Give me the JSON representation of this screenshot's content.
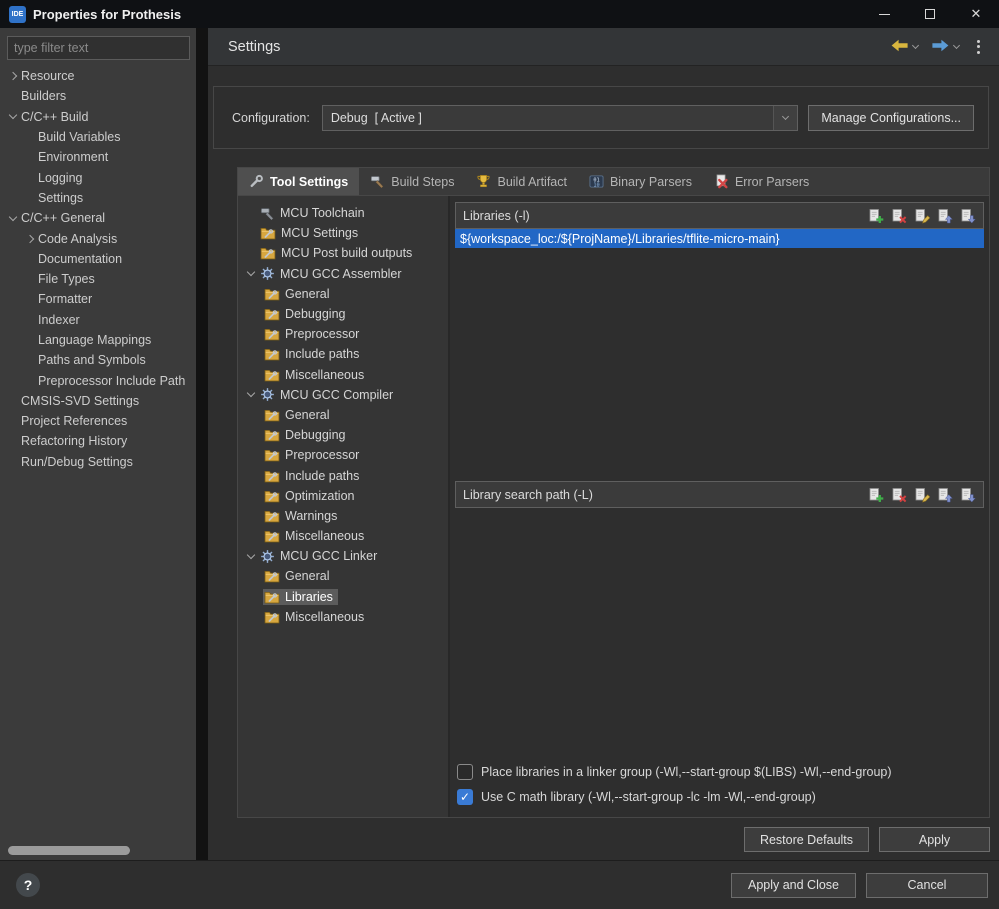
{
  "window": {
    "title": "Properties for Prothesis",
    "icon_text": "IDE"
  },
  "header": {
    "title": "Settings"
  },
  "help": {
    "glyph": "?"
  },
  "sidebar": {
    "filter_placeholder": "type filter text",
    "tree": [
      {
        "label": "Resource",
        "level": 0,
        "chevron": "collapsed"
      },
      {
        "label": "Builders",
        "level": 0,
        "chevron": null
      },
      {
        "label": "C/C++ Build",
        "level": 0,
        "chevron": "expanded"
      },
      {
        "label": "Build Variables",
        "level": 1,
        "chevron": null
      },
      {
        "label": "Environment",
        "level": 1,
        "chevron": null
      },
      {
        "label": "Logging",
        "level": 1,
        "chevron": null
      },
      {
        "label": "Settings",
        "level": 1,
        "chevron": null
      },
      {
        "label": "C/C++ General",
        "level": 0,
        "chevron": "expanded"
      },
      {
        "label": "Code Analysis",
        "level": 1,
        "chevron": "collapsed"
      },
      {
        "label": "Documentation",
        "level": 1,
        "chevron": null
      },
      {
        "label": "File Types",
        "level": 1,
        "chevron": null
      },
      {
        "label": "Formatter",
        "level": 1,
        "chevron": null
      },
      {
        "label": "Indexer",
        "level": 1,
        "chevron": null
      },
      {
        "label": "Language Mappings",
        "level": 1,
        "chevron": null
      },
      {
        "label": "Paths and Symbols",
        "level": 1,
        "chevron": null
      },
      {
        "label": "Preprocessor Include Path",
        "level": 1,
        "chevron": null
      },
      {
        "label": "CMSIS-SVD Settings",
        "level": 0,
        "chevron": null
      },
      {
        "label": "Project References",
        "level": 0,
        "chevron": null
      },
      {
        "label": "Refactoring History",
        "level": 0,
        "chevron": null
      },
      {
        "label": "Run/Debug Settings",
        "level": 0,
        "chevron": null
      }
    ]
  },
  "config": {
    "label": "Configuration:",
    "value": "Debug  [ Active ]",
    "manage": "Manage Configurations..."
  },
  "tabs": [
    {
      "label": "Tool Settings",
      "icon": "wrench-icon",
      "active": true
    },
    {
      "label": "Build Steps",
      "icon": "hammer-icon",
      "active": false
    },
    {
      "label": "Build Artifact",
      "icon": "trophy-icon",
      "active": false
    },
    {
      "label": "Binary Parsers",
      "icon": "binary-icon",
      "active": false
    },
    {
      "label": "Error Parsers",
      "icon": "error-icon",
      "active": false
    }
  ],
  "tool_tree": [
    {
      "label": "MCU Toolchain",
      "level": 0,
      "icon": "toolchain-icon",
      "chevron": null,
      "selected": false
    },
    {
      "label": "MCU Settings",
      "level": 0,
      "icon": "folder-icon",
      "chevron": null,
      "selected": false
    },
    {
      "label": "MCU Post build outputs",
      "level": 0,
      "icon": "folder-icon",
      "chevron": null,
      "selected": false
    },
    {
      "label": "MCU GCC Assembler",
      "level": 0,
      "icon": "gear-icon",
      "chevron": "expanded",
      "selected": false
    },
    {
      "label": "General",
      "level": 1,
      "icon": "folder-icon",
      "chevron": null,
      "selected": false
    },
    {
      "label": "Debugging",
      "level": 1,
      "icon": "folder-icon",
      "chevron": null,
      "selected": false
    },
    {
      "label": "Preprocessor",
      "level": 1,
      "icon": "folder-icon",
      "chevron": null,
      "selected": false
    },
    {
      "label": "Include paths",
      "level": 1,
      "icon": "folder-icon",
      "chevron": null,
      "selected": false
    },
    {
      "label": "Miscellaneous",
      "level": 1,
      "icon": "folder-icon",
      "chevron": null,
      "selected": false
    },
    {
      "label": "MCU GCC Compiler",
      "level": 0,
      "icon": "gear-icon",
      "chevron": "expanded",
      "selected": false
    },
    {
      "label": "General",
      "level": 1,
      "icon": "folder-icon",
      "chevron": null,
      "selected": false
    },
    {
      "label": "Debugging",
      "level": 1,
      "icon": "folder-icon",
      "chevron": null,
      "selected": false
    },
    {
      "label": "Preprocessor",
      "level": 1,
      "icon": "folder-icon",
      "chevron": null,
      "selected": false
    },
    {
      "label": "Include paths",
      "level": 1,
      "icon": "folder-icon",
      "chevron": null,
      "selected": false
    },
    {
      "label": "Optimization",
      "level": 1,
      "icon": "folder-icon",
      "chevron": null,
      "selected": false
    },
    {
      "label": "Warnings",
      "level": 1,
      "icon": "folder-icon",
      "chevron": null,
      "selected": false
    },
    {
      "label": "Miscellaneous",
      "level": 1,
      "icon": "folder-icon",
      "chevron": null,
      "selected": false
    },
    {
      "label": "MCU GCC Linker",
      "level": 0,
      "icon": "gear-icon",
      "chevron": "expanded",
      "selected": false
    },
    {
      "label": "General",
      "level": 1,
      "icon": "folder-icon",
      "chevron": null,
      "selected": false
    },
    {
      "label": "Libraries",
      "level": 1,
      "icon": "folder-icon",
      "chevron": null,
      "selected": true
    },
    {
      "label": "Miscellaneous",
      "level": 1,
      "icon": "folder-icon",
      "chevron": null,
      "selected": false
    }
  ],
  "libraries": {
    "title": "Libraries (-l)",
    "toolbar": [
      "add-icon",
      "delete-icon",
      "edit-icon",
      "move-up-icon",
      "move-down-icon"
    ],
    "items": [
      {
        "text": "${workspace_loc:/${ProjName}/Libraries/tflite-micro-main}",
        "selected": true
      }
    ]
  },
  "search_path": {
    "title": "Library search path (-L)",
    "toolbar": [
      "add-icon",
      "delete-icon",
      "edit-icon",
      "move-up-icon",
      "move-down-icon"
    ],
    "items": []
  },
  "options": [
    {
      "label": "Place libraries in a linker group (-Wl,--start-group $(LIBS) -Wl,--end-group)",
      "checked": false
    },
    {
      "label": "Use C math library (-Wl,--start-group -lc -lm -Wl,--end-group)",
      "checked": true
    }
  ],
  "buttons": {
    "restore_defaults": "Restore Defaults",
    "apply": "Apply",
    "apply_and_close": "Apply and Close",
    "cancel": "Cancel"
  },
  "colors": {
    "selection_blue": "#2267c5",
    "checkbox_blue": "#3a7bd5",
    "back_arrow": "#d9b63e",
    "forward_arrow": "#5b9bd5",
    "folder_yellow": "#d7a73f"
  }
}
